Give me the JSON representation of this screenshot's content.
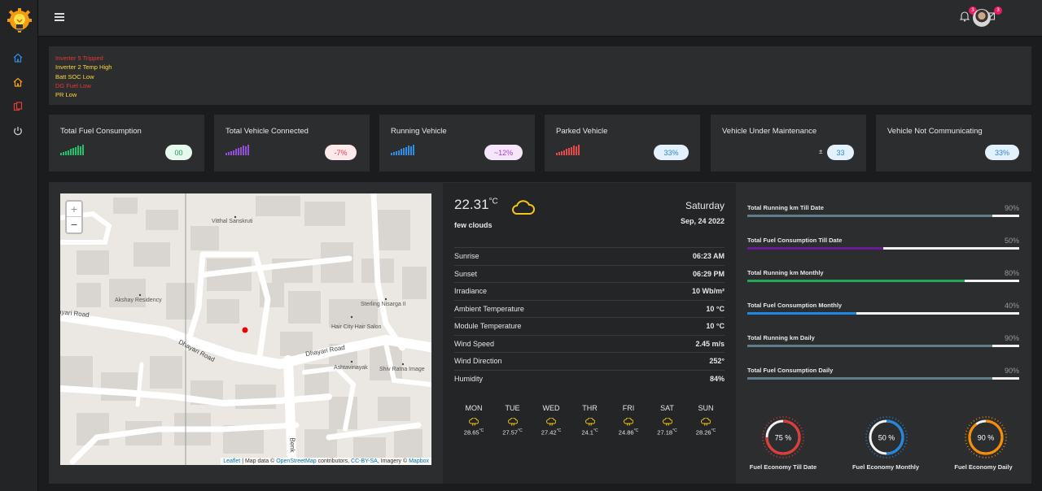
{
  "alerts": [
    {
      "text": "Inverter 5 Tripped",
      "color": "#e53935"
    },
    {
      "text": "Inverter 2 Temp High",
      "color": "#fdd835"
    },
    {
      "text": "Batt SOC Low",
      "color": "#fdd835"
    },
    {
      "text": "DG Fuel Low",
      "color": "#e53935"
    },
    {
      "text": "PR Low",
      "color": "#fdd835"
    }
  ],
  "topbar": {
    "notif_count": "3",
    "mail_count": "3"
  },
  "cards": [
    {
      "title": "Total Fuel Consumption",
      "value": "00",
      "spark_color": "#21c16b",
      "pill_bg": "#e7f8ee",
      "pill_fg": "#19a35a"
    },
    {
      "title": "Total Vehicle Connected",
      "value": "-7%",
      "spark_color": "#8f4fd6",
      "pill_bg": "#fde9ea",
      "pill_fg": "#e53950"
    },
    {
      "title": "Running Vehicle",
      "value": "~12%",
      "spark_color": "#2f8de4",
      "pill_bg": "#f6e6fb",
      "pill_fg": "#b13ad6"
    },
    {
      "title": "Parked Vehicle",
      "value": "33%",
      "spark_color": "#e54a4a",
      "pill_bg": "#e3f1fc",
      "pill_fg": "#2f86d6"
    },
    {
      "title": "Vehicle Under Maintenance",
      "value": "33",
      "prefix": "±",
      "spark_color": "",
      "pill_bg": "#e3f1fc",
      "pill_fg": "#2f86d6"
    },
    {
      "title": "Vehicle Not Communicating",
      "value": "33%",
      "spark_color": "",
      "pill_bg": "#e3f1fc",
      "pill_fg": "#2f86d6"
    }
  ],
  "map": {
    "labels": {
      "vitthal": "Vitthal Sanskruti",
      "akshay": "Akshay Residency",
      "dhayari1": "ayari Road",
      "dhayari2": "Dhayari Road",
      "dhayari3": "Dhayari Road",
      "sterling": "Sterling Nisarga II",
      "hair": "Hair City Hair Salon",
      "ashta": "Ashtavinayak",
      "shiv": "Shiv Ratna Image",
      "benk": "Benk"
    },
    "zoom_in": "+",
    "zoom_out": "−",
    "attribution": {
      "leaflet": "Leaflet",
      "text1": " | Map data © ",
      "osm": "OpenStreetMap",
      "text2": " contributors, ",
      "ccbysa": "CC-BY-SA",
      "text3": ", Imagery © ",
      "mapbox": "Mapbox"
    }
  },
  "weather": {
    "temp": "22.31",
    "unit": "°C",
    "desc": "few clouds",
    "day": "Saturday",
    "date": "Sep, 24 2022",
    "rows": [
      {
        "label": "Sunrise",
        "value": "06:23 AM"
      },
      {
        "label": "Sunset",
        "value": "06:29 PM"
      },
      {
        "label": "Irradiance",
        "value": "10 Wb/m²"
      },
      {
        "label": "Ambient Temperature",
        "value": "10 °C"
      },
      {
        "label": "Module Temperature",
        "value": "10 °C"
      },
      {
        "label": "Wind Speed",
        "value": "2.45 m/s"
      },
      {
        "label": "Wind Direction",
        "value": "252°"
      },
      {
        "label": "Humidity",
        "value": "84%"
      }
    ],
    "forecast": [
      {
        "day": "MON",
        "temp": "28.65",
        "unit": "°C"
      },
      {
        "day": "TUE",
        "temp": "27.57",
        "unit": "°C"
      },
      {
        "day": "WED",
        "temp": "27.42",
        "unit": "°C"
      },
      {
        "day": "THR",
        "temp": "24.1",
        "unit": "°C"
      },
      {
        "day": "FRI",
        "temp": "24.86",
        "unit": "°C"
      },
      {
        "day": "SAT",
        "temp": "27.18",
        "unit": "°C"
      },
      {
        "day": "SUN",
        "temp": "28.26",
        "unit": "°C"
      }
    ]
  },
  "progress": [
    {
      "label": "Total Running km Till Date",
      "pct_text": "90%",
      "value": 0.9,
      "color": "#607d8b"
    },
    {
      "label": "Total Fuel Consumption Till Date",
      "pct_text": "50%",
      "value": 0.5,
      "color": "#6a1b9a"
    },
    {
      "label": "Total Running km Monthly",
      "pct_text": "80%",
      "value": 0.8,
      "color": "#21a957"
    },
    {
      "label": "Total Fuel Consumption Monthly",
      "pct_text": "40%",
      "value": 0.4,
      "color": "#1e88e5"
    },
    {
      "label": "Total Running km Daily",
      "pct_text": "90%",
      "value": 0.9,
      "color": "#607d8b"
    },
    {
      "label": "Total Fuel Consumption Daily",
      "pct_text": "90%",
      "value": 0.9,
      "color": "#607d8b"
    }
  ],
  "gauges": [
    {
      "label": "Fuel Economy Till Date",
      "text": "75 %",
      "value": 0.75,
      "color": "#e53935"
    },
    {
      "label": "Fuel Economy Monthly",
      "text": "50 %",
      "value": 0.5,
      "color": "#1e88e5"
    },
    {
      "label": "Fuel Economy Daily",
      "text": "90 %",
      "value": 0.9,
      "color": "#fb8c00"
    }
  ]
}
